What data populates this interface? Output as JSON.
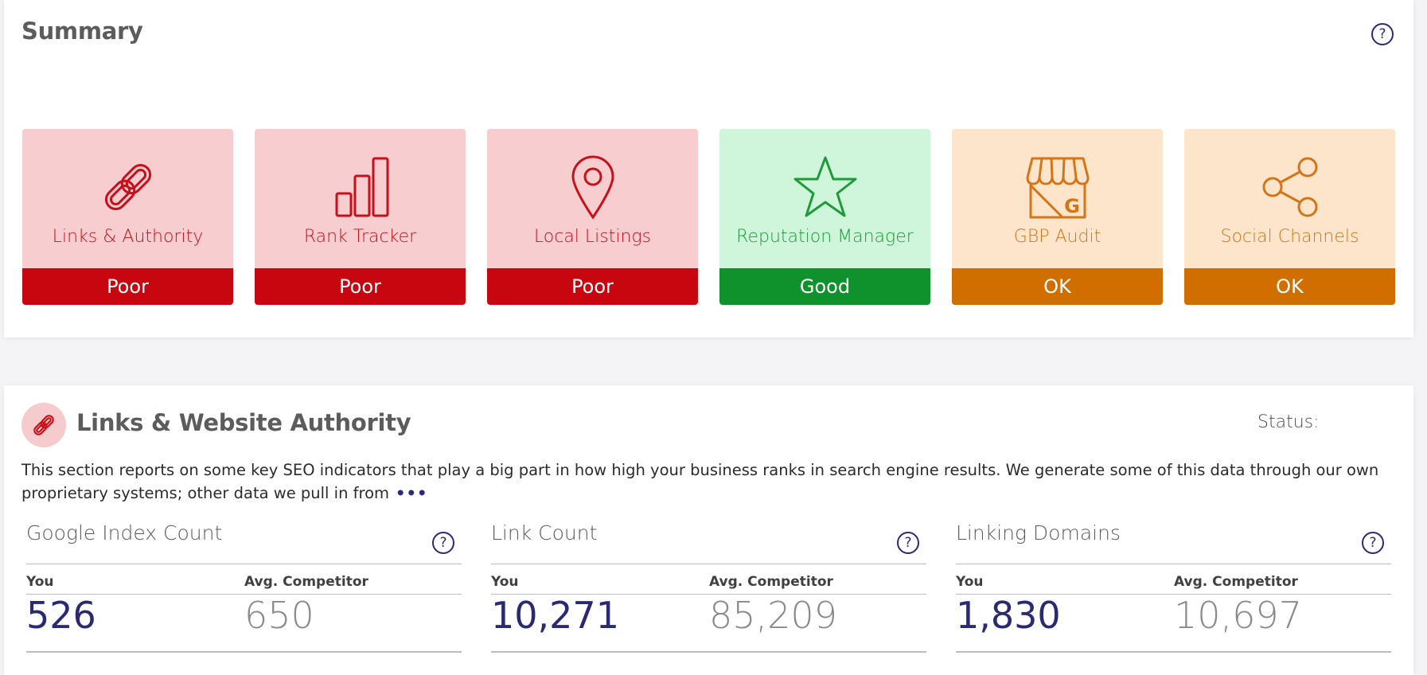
{
  "summary": {
    "title": "Summary",
    "help": "?",
    "cards": [
      {
        "label": "Links & Authority",
        "status": "Poor",
        "icon": "link-icon"
      },
      {
        "label": "Rank Tracker",
        "status": "Poor",
        "icon": "bar-chart-icon"
      },
      {
        "label": "Local Listings",
        "status": "Poor",
        "icon": "map-pin-icon"
      },
      {
        "label": "Reputation Manager",
        "status": "Good",
        "icon": "star-icon"
      },
      {
        "label": "GBP Audit",
        "status": "OK",
        "icon": "storefront-icon"
      },
      {
        "label": "Social Channels",
        "status": "OK",
        "icon": "share-icon"
      }
    ]
  },
  "colors": {
    "poor_bg": "#f7cdcf",
    "poor_fg": "#c7101a",
    "poor_bar": "#c7060f",
    "good_bg": "#cff5da",
    "good_fg": "#1f9a38",
    "good_bar": "#0f922b",
    "ok_bg": "#fde5cc",
    "ok_fg": "#d47517",
    "ok_bar": "#d06e00",
    "accent": "#2a2a72"
  },
  "links_section": {
    "title": "Links & Website Authority",
    "status_label": "Status:",
    "description": "This section reports on some key SEO indicators that play a big part in how high your business ranks in search engine results. We generate some of this data through our own proprietary systems; other data we pull in from",
    "more": "•••",
    "metrics": [
      {
        "title": "Google Index Count",
        "you_label": "You",
        "comp_label": "Avg. Competitor",
        "you": "526",
        "comp": "650"
      },
      {
        "title": "Link Count",
        "you_label": "You",
        "comp_label": "Avg. Competitor",
        "you": "10,271",
        "comp": "85,209"
      },
      {
        "title": "Linking Domains",
        "you_label": "You",
        "comp_label": "Avg. Competitor",
        "you": "1,830",
        "comp": "10,697"
      }
    ]
  }
}
